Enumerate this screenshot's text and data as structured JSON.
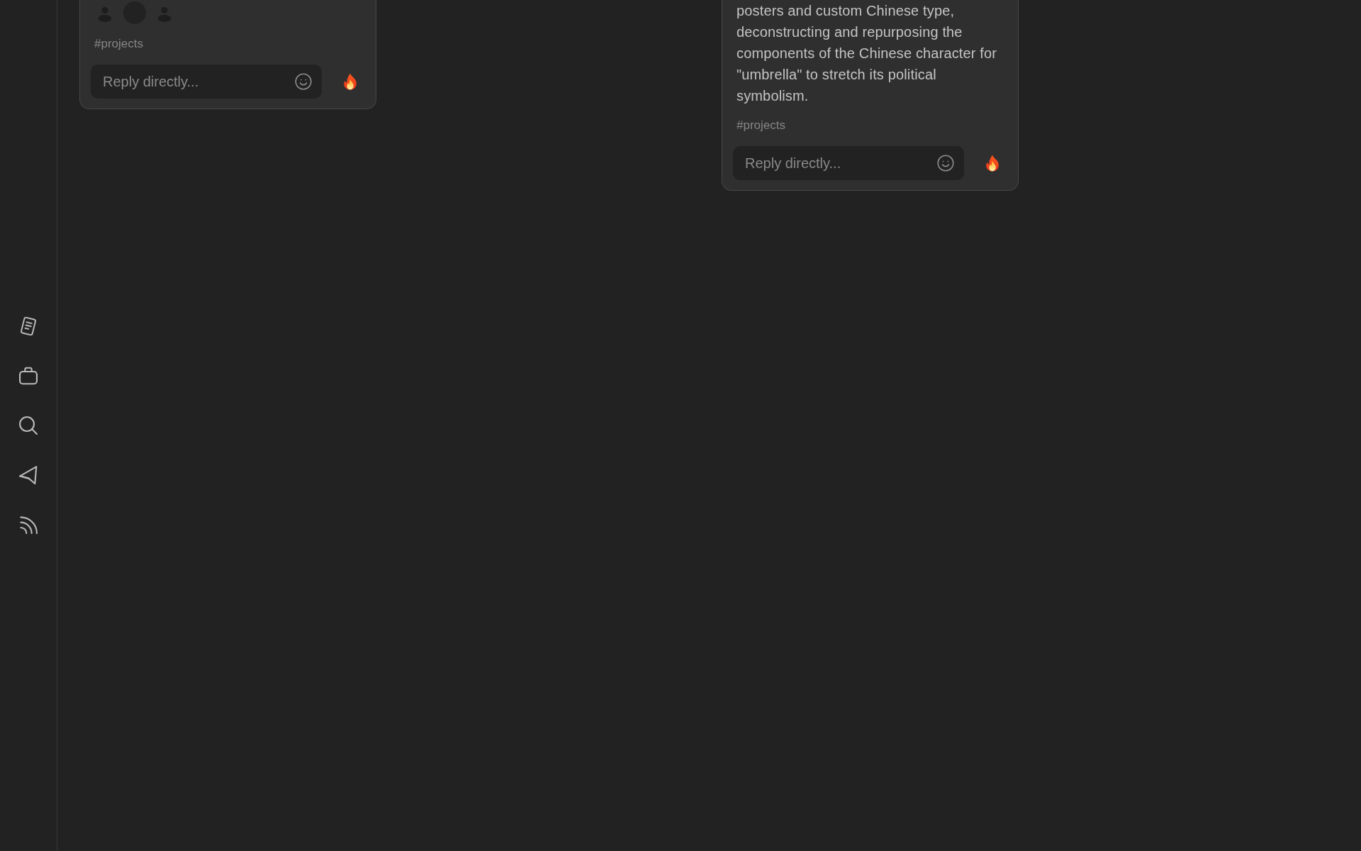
{
  "cards": [
    {
      "avatars": [
        {
          "kind": "silhouette"
        },
        {
          "kind": "circle"
        },
        {
          "kind": "silhouette"
        }
      ],
      "tag": "#projects",
      "reply": {
        "placeholder": "Reply directly..."
      }
    },
    {
      "body": "posters and custom Chinese type, deconstructing and repurposing the components of the Chinese character for \"umbrella\" to stretch its political symbolism.",
      "tag": "#projects",
      "reply": {
        "placeholder": "Reply directly..."
      }
    }
  ]
}
